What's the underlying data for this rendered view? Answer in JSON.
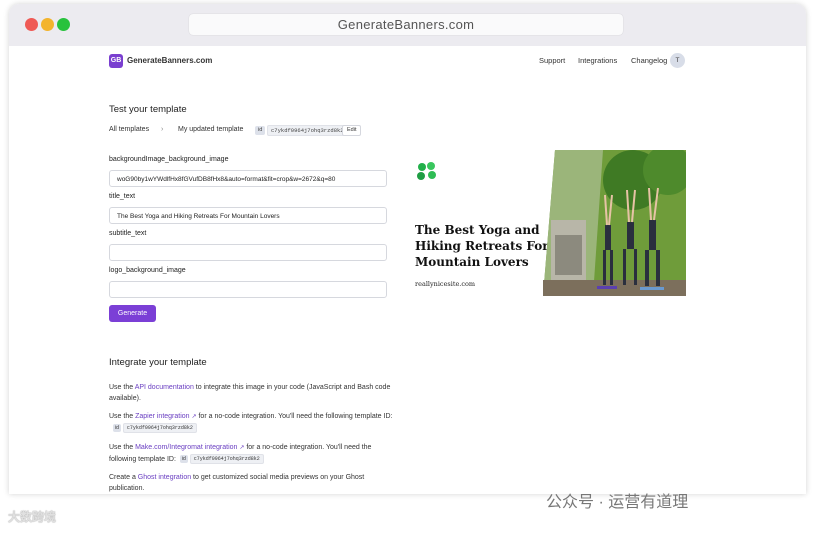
{
  "browser": {
    "url": "GenerateBanners.com"
  },
  "header": {
    "logo_mark": "GB",
    "brand": "GenerateBanners.com",
    "nav": [
      "Support",
      "Integrations",
      "Changelog"
    ],
    "avatar_initial": "T"
  },
  "test": {
    "heading": "Test your template",
    "breadcrumb_all": "All templates",
    "breadcrumb_sep": "›",
    "breadcrumb_current": "My updated template",
    "id_label": "id",
    "template_id": "c7ykdf0964j7ohq3rzd8k2",
    "edit_label": "Edit",
    "fields": [
      {
        "label": "backgroundImage_background_image",
        "value": "woG90by1wYWdlfHx8fGVufDB8fHx8&auto=format&fit=crop&w=2672&q=80"
      },
      {
        "label": "title_text",
        "value": "The Best Yoga and Hiking Retreats For Mountain Lovers"
      },
      {
        "label": "subtitle_text",
        "value": ""
      },
      {
        "label": "logo_background_image",
        "value": ""
      }
    ],
    "generate_label": "Generate"
  },
  "preview": {
    "title": "The Best Yoga and Hiking Retreats For Mountain Lovers",
    "site": "reallynicesite.com"
  },
  "integrate": {
    "heading": "Integrate your template",
    "api": {
      "pre": "Use the ",
      "link": "API documentation",
      "post": " to integrate this image in your code (JavaScript and Bash code available)."
    },
    "zapier": {
      "pre": "Use the ",
      "link": "Zapier integration",
      "post": " for a no-code integration. You'll need the following template ID:"
    },
    "make": {
      "pre": "Use the ",
      "link": "Make.com/Integromat integration",
      "post": " for a no-code integration. You'll need the following template ID:"
    },
    "ghost": {
      "pre": "Create a ",
      "link": "Ghost integration",
      "post": " to get customized social media previews on your Ghost publication."
    },
    "id_label": "id",
    "template_id": "c7ykdf0964j7ohq3rzd8k2"
  },
  "watermarks": {
    "left": "大数跨境",
    "right": "公众号 · 运营有道理"
  },
  "colors": {
    "accent": "#7b3fd6",
    "link": "#6a3fc2"
  }
}
